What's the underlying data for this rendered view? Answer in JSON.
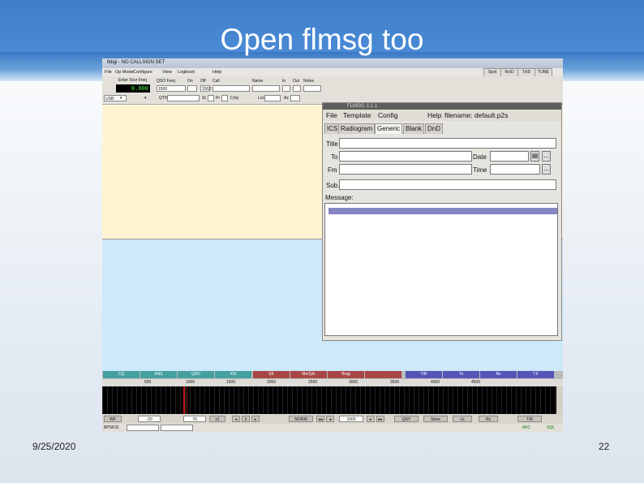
{
  "slide": {
    "title": "Open flmsg too",
    "date": "9/25/2020",
    "page_number": "22"
  },
  "fldigi": {
    "window_title": "fldigi - NO CALLSIGN SET",
    "menu": [
      "File",
      "Op Mode",
      "Configure",
      "View",
      "Logbook",
      "Help"
    ],
    "toolbar_buttons": [
      "Spot",
      "RxID",
      "TxID",
      "TUNE"
    ],
    "qso": {
      "enter_xcvr_freq": "Enter Xcvr Freq",
      "frequency": "0.000",
      "qso_freq_label": "QSO Freq",
      "qso_freq": "1500",
      "on_label": "On",
      "off_label": "Off",
      "off_value": "1502",
      "call_label": "Call",
      "name_label": "Name",
      "in_label": "In",
      "out_label": "Out",
      "notes_label": "Notes",
      "mode": "USB",
      "qth_label": "QTH",
      "st_label": "St",
      "pr_label": "Pr",
      "cnty_label": "Cnty",
      "loc_label": "Loc",
      "az_label": "Az"
    },
    "macros": [
      "CQ",
      "ANS",
      "QSO",
      "KN",
      "SK",
      "Me/Qth",
      "Brag",
      "",
      "T/R",
      "Tx",
      "Rx",
      "TX"
    ],
    "scale": [
      "500",
      "1000",
      "1500",
      "2000",
      "2500",
      "3000",
      "3500",
      "4000",
      "4500"
    ],
    "controls": [
      "WF",
      "-20",
      "70",
      "x1",
      "NORM",
      "1500",
      "QSY",
      "Store",
      "Lk",
      "Rv",
      "T/R"
    ],
    "status": {
      "mode": "BPSK31",
      "afc": "AFC",
      "sql": "SQL"
    }
  },
  "flmsg": {
    "window_title": "FLMSG: 1.1.1",
    "menu": [
      "File",
      "Template",
      "Config",
      "Help"
    ],
    "filename": "filename: default.p2s",
    "tabs": [
      "ICS",
      "Radiogram",
      "Generic",
      "Blank",
      "DnD"
    ],
    "active_tab": "Generic",
    "fields": {
      "title": "Title",
      "to": "To",
      "fm": "Fm",
      "date": "Date",
      "time": "Time",
      "sub": "Sub.",
      "message": "Message:"
    },
    "buttons": {
      "date_picker": "...",
      "time_picker": "..."
    }
  }
}
